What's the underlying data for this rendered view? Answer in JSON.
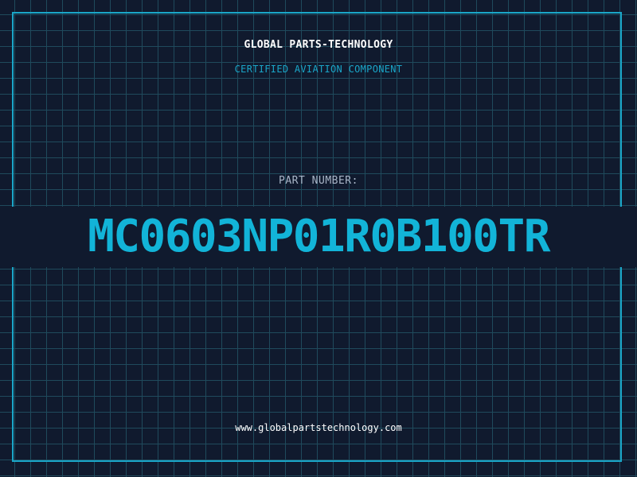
{
  "header": {
    "company": "GLOBAL PARTS-TECHNOLOGY",
    "subtitle": "CERTIFIED AVIATION COMPONENT"
  },
  "part": {
    "label": "PART NUMBER:",
    "number": "MC0603NP01R0B100TR"
  },
  "footer": {
    "url": "www.globalpartstechnology.com"
  },
  "colors": {
    "background": "#101a2e",
    "grid": "#1f4a5c",
    "accent": "#1aa6c8",
    "part_number": "#12b4d8"
  }
}
